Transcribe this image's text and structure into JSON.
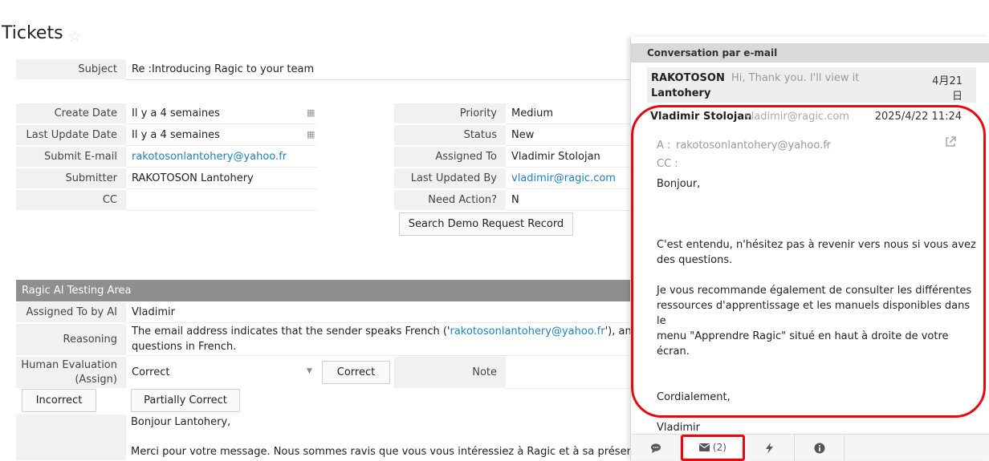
{
  "page": {
    "title": "Tickets",
    "star_icon": "star-icon"
  },
  "subject": {
    "label": "Subject",
    "value": "Re :Introducing Ragic to your team"
  },
  "left_fields": [
    {
      "label": "Create Date",
      "value": "Il y a 4 semaines"
    },
    {
      "label": "Last Update Date",
      "value": "Il y a 4 semaines"
    },
    {
      "label": "Submit E-mail",
      "value": "rakotosonlantohery@yahoo.fr"
    },
    {
      "label": "Submitter",
      "value": "RAKOTOSON Lantohery"
    },
    {
      "label": "CC",
      "value": ""
    }
  ],
  "right_fields": [
    {
      "label": "Priority",
      "value": "Medium"
    },
    {
      "label": "Status",
      "value": "New"
    },
    {
      "label": "Assigned To",
      "value": "Vladimir Stolojan"
    },
    {
      "label": "Last Updated By",
      "value": "vladimir@ragic.com"
    },
    {
      "label": "Need Action?",
      "value": "N"
    }
  ],
  "search_demo_button": "Search Demo Request Record",
  "ai_section": {
    "title": "Ragic AI Testing Area",
    "assigned_label": "Assigned To by AI",
    "assigned_value": "Vladimir",
    "reasoning_label": "Reasoning",
    "reasoning_pre": "The email address indicates that the sender speaks French ('",
    "reasoning_link": "rakotosonlantohery@yahoo.fr",
    "reasoning_post": "'), and Vladimir",
    "reasoning_line2": "questions in French.",
    "human_eval_label_1": "Human Evaluation",
    "human_eval_label_2": "(Assign)",
    "human_eval_value": "Correct",
    "correct_button": "Correct",
    "note_label": "Note",
    "incorrect_button": "Incorrect",
    "partially_correct_button": "Partially Correct",
    "reply_line1": "Bonjour Lantohery,",
    "reply_line2": "Merci pour votre message. Nous sommes ravis que vous vous intéressiez à Ragic et à sa présentation pou"
  },
  "panel": {
    "header": "Conversation par e-mail",
    "thread": {
      "sender_line1": "RAKOTOSON",
      "sender_line2": "Lantohery",
      "preview": "Hi, Thank you. I'll view it",
      "date": "4月21日"
    },
    "message": {
      "from_name": "Vladimir Stolojan",
      "from_email": "vladimir@ragic.com",
      "datetime": "2025/4/22 11:24",
      "to_label": "A :",
      "to_value": "rakotosonlantohery@yahoo.fr",
      "cc_label": "CC :",
      "greeting": "Bonjour,",
      "p1_l1": "C'est entendu, n'hésitez pas à revenir vers nous si vous avez",
      "p1_l2": "des questions.",
      "p2_l1": "Je vous recommande également de consulter les différentes",
      "p2_l2": "ressources d'apprentissage et les manuels disponibles dans le",
      "p2_l3": "menu \"Apprendre Ragic\" situé en haut à droite de votre écran.",
      "closing": "Cordialement,",
      "signature": "Vladimir"
    },
    "toolbar": {
      "comment_icon": "comment-icon",
      "mail_count": "(2)",
      "bolt_icon": "bolt-icon",
      "info_icon": "info-icon"
    }
  },
  "colors": {
    "highlight": "#e8090f",
    "link": "#1f7fbf",
    "section_header": "#8f8f8f"
  }
}
